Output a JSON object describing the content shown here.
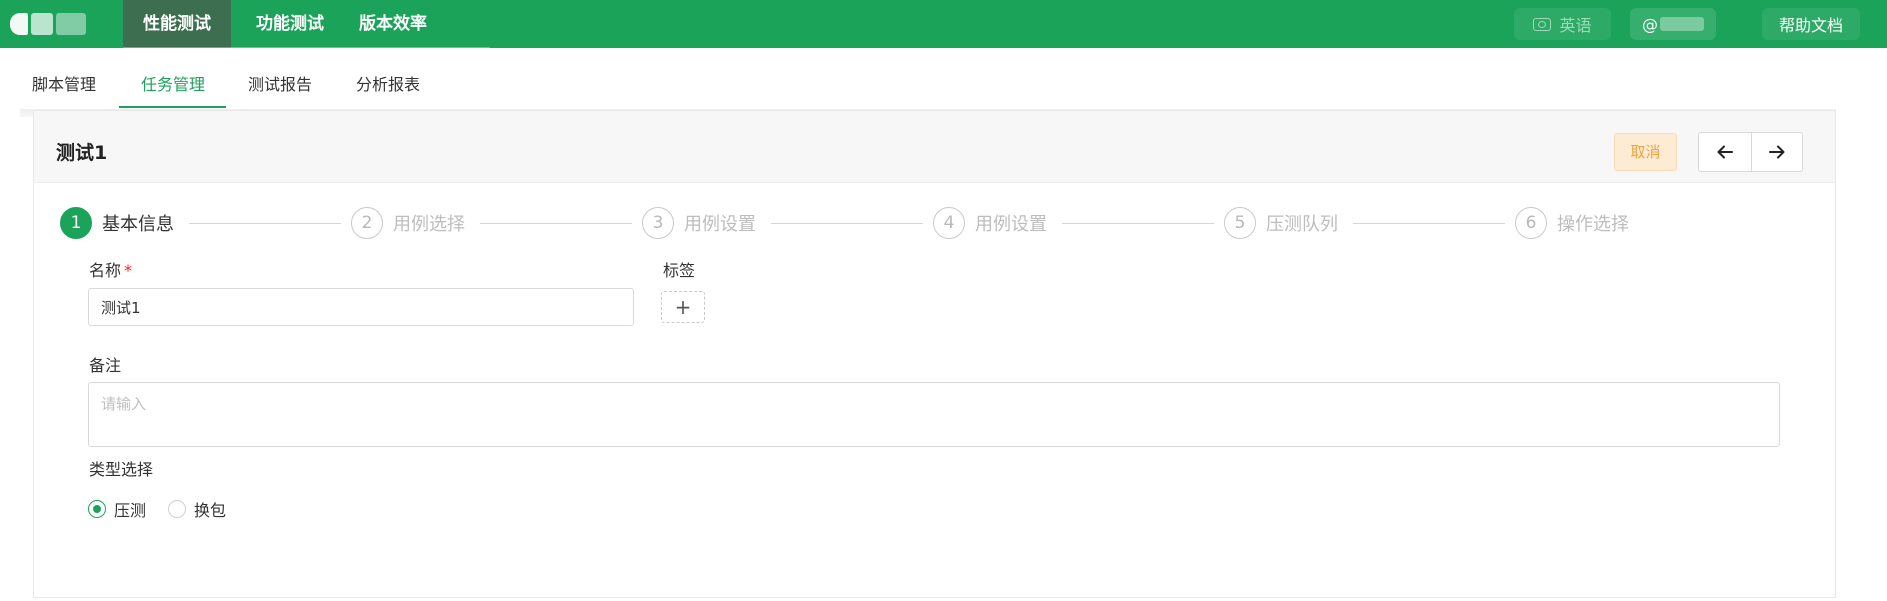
{
  "topbar": {
    "tabs": [
      {
        "label": "性能测试",
        "active": true
      },
      {
        "label": "功能测试",
        "active": false
      },
      {
        "label": "版本效率",
        "active": false
      }
    ],
    "language_label": "英语",
    "user_label": "@",
    "help_label": "帮助文档"
  },
  "subtabs": [
    {
      "label": "脚本管理",
      "active": false
    },
    {
      "label": "任务管理",
      "active": true
    },
    {
      "label": "测试报告",
      "active": false
    },
    {
      "label": "分析报表",
      "active": false
    }
  ],
  "card": {
    "title": "测试1",
    "cancel_label": "取消"
  },
  "steps": [
    {
      "num": "1",
      "label": "基本信息",
      "status": "active"
    },
    {
      "num": "2",
      "label": "用例选择",
      "status": "wait"
    },
    {
      "num": "3",
      "label": "用例设置",
      "status": "wait"
    },
    {
      "num": "4",
      "label": "用例设置",
      "status": "wait"
    },
    {
      "num": "5",
      "label": "压测队列",
      "status": "wait"
    },
    {
      "num": "6",
      "label": "操作选择",
      "status": "wait"
    }
  ],
  "form": {
    "name_label": "名称",
    "name_required_mark": "*",
    "name_value": "测试1",
    "tag_label": "标签",
    "tag_add_glyph": "+",
    "remark_label": "备注",
    "remark_placeholder": "请输入",
    "type_label": "类型选择",
    "type_options": [
      {
        "label": "压测",
        "checked": true
      },
      {
        "label": "换包",
        "checked": false
      }
    ]
  },
  "colors": {
    "brand_green": "#1ba35a",
    "active_nav_bg": "#3d6e50",
    "cancel_bg": "#fdebd3",
    "cancel_text": "#f0a340"
  }
}
